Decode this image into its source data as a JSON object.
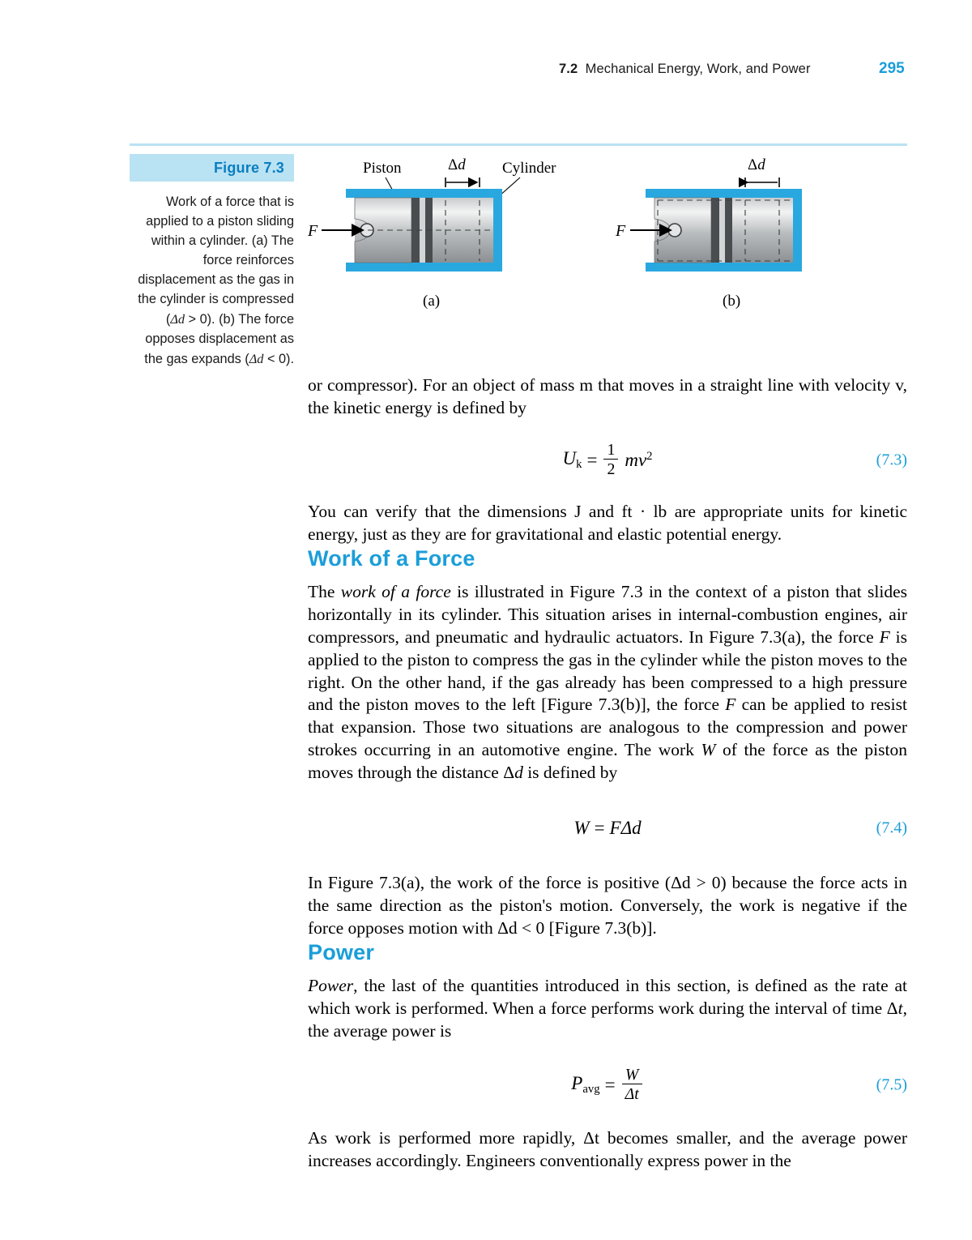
{
  "header": {
    "section_number": "7.2",
    "section_title": "Mechanical Energy, Work, and Power",
    "page_number": "295"
  },
  "figure": {
    "label": "Figure 7.3",
    "caption": "Work of a force that is applied to a piston sliding within a cylinder. (a) The force reinforces displacement as the gas in the cylinder is compressed (Δd > 0). (b) The force opposes displacement as the gas expands (Δd < 0).",
    "annotations": {
      "piston": "Piston",
      "cylinder": "Cylinder",
      "delta_d_a": "Δd",
      "delta_d_b": "Δd",
      "force_a": "F",
      "force_b": "F",
      "sublabel_a": "(a)",
      "sublabel_b": "(b)"
    }
  },
  "body": {
    "para_kinetic_intro": "or compressor). For an object of mass m that moves in a straight line with velocity v, the kinetic energy is defined by",
    "eq_7_3": {
      "lhs": "U",
      "lhs_sub": "k",
      "eq": "=",
      "frac_num": "1",
      "frac_den": "2",
      "rhs": "mv",
      "rhs_sup": "2",
      "number": "(7.3)"
    },
    "para_units": "You can verify that the dimensions J and ft · lb are appropriate units for kinetic energy, just as they are for gravitational and elastic potential energy.",
    "heading_work": "Work of a Force",
    "para_work_1": "The work of a force is illustrated in Figure 7.3 in the context of a piston that slides horizontally in its cylinder. This situation arises in internal-combustion engines, air compressors, and pneumatic and hydraulic actuators. In Figure 7.3(a), the force F is applied to the piston to compress the gas in the cylinder while the piston moves to the right. On the other hand, if the gas already has been compressed to a high pressure and the piston moves to the left [Figure 7.3(b)], the force F can be applied to resist that expansion. Those two situations are analogous to the compression and power strokes occurring in an automotive engine. The work W of the force as the piston moves through the distance Δd is defined by",
    "eq_7_4": {
      "lhs": "W",
      "eq": "=",
      "rhs": "FΔd",
      "number": "(7.4)"
    },
    "para_work_2": "In Figure 7.3(a), the work of the force is positive (Δd > 0) because the force acts in the same direction as the piston's motion. Conversely, the work is negative if the force opposes motion with Δd < 0 [Figure 7.3(b)].",
    "heading_power": "Power",
    "para_power_1": "Power, the last of the quantities introduced in this section, is defined as the rate at which work is performed. When a force performs work during the interval of time Δt, the average power is",
    "eq_7_5": {
      "lhs": "P",
      "lhs_sub": "avg",
      "eq": "=",
      "frac_num": "W",
      "frac_den": "Δt",
      "number": "(7.5)"
    },
    "para_power_2": "As work is performed more rapidly, Δt becomes smaller, and the average power increases accordingly. Engineers conventionally express power in the"
  },
  "colors": {
    "accent": "#1a9ed9",
    "figure_band": "#b9e2f3",
    "cylinder_blue": "#29a8e0"
  }
}
